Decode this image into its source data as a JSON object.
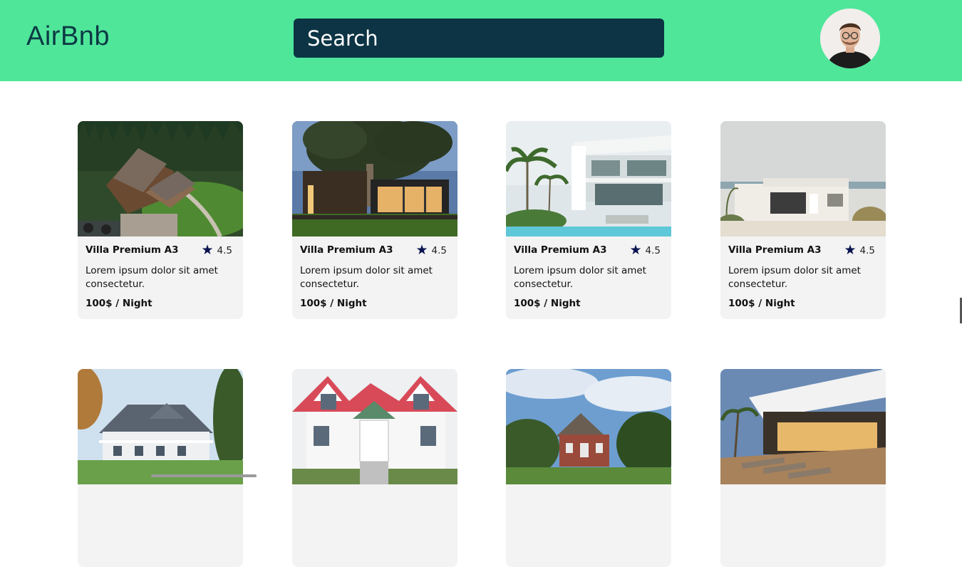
{
  "header": {
    "logo": "AirBnb",
    "search_label": "Search"
  },
  "listings": [
    {
      "title": "Villa Premium A3",
      "rating": "4.5",
      "description": "Lorem ipsum dolor sit amet consectetur.",
      "price": "100$ / Night",
      "image": "wooden lodge in forest"
    },
    {
      "title": "Villa Premium A3",
      "rating": "4.5",
      "description": "Lorem ipsum dolor sit amet consectetur.",
      "price": "100$ / Night",
      "image": "modern dark house with tree at dusk"
    },
    {
      "title": "Villa Premium A3",
      "rating": "4.5",
      "description": "Lorem ipsum dolor sit amet consectetur.",
      "price": "100$ / Night",
      "image": "white modern villa with pool and palms"
    },
    {
      "title": "Villa Premium A3",
      "rating": "4.5",
      "description": "Lorem ipsum dolor sit amet consectetur.",
      "price": "100$ / Night",
      "image": "white beach house by the sea"
    },
    {
      "title": "",
      "rating": "",
      "description": "",
      "price": "",
      "image": "grey victorian house with porch"
    },
    {
      "title": "",
      "rating": "",
      "description": "",
      "price": "",
      "image": "white house with red roof"
    },
    {
      "title": "",
      "rating": "",
      "description": "",
      "price": "",
      "image": "brick suburban house"
    },
    {
      "title": "",
      "rating": "",
      "description": "",
      "price": "",
      "image": "villa terrace with sun loungers"
    }
  ],
  "colors": {
    "header_bg": "#4fe69a",
    "search_bg": "#0c3444",
    "logo_text": "#0d3a44",
    "card_bg": "#f3f3f3",
    "star": "#0a1450"
  }
}
